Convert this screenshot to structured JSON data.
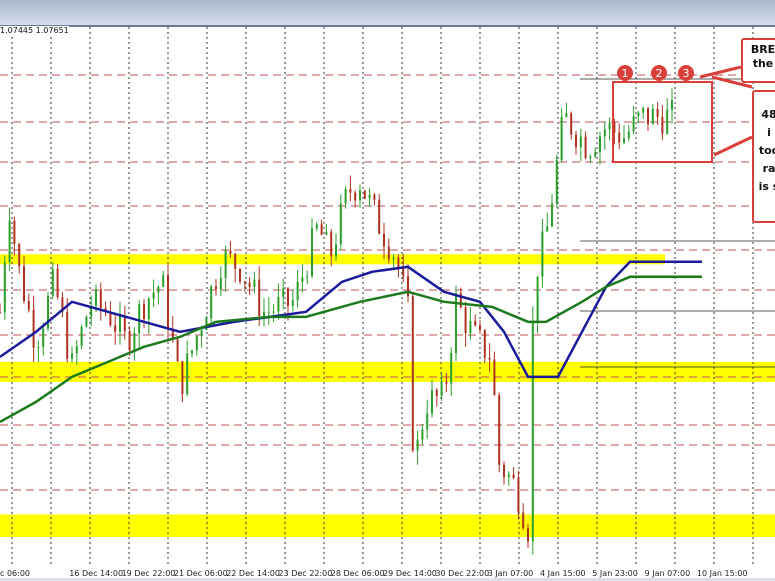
{
  "header": {
    "ohlc_text": "1.07445 1.07651"
  },
  "chart_data": {
    "type": "candlestick",
    "title": "",
    "xlabel": "",
    "ylabel": "",
    "x_tick_labels": [
      "c 06:00",
      "16 Dec 14:00",
      "19 Dec 22:00",
      "21 Dec 06:00",
      "22 Dec 14:00",
      "23 Dec 22:00",
      "28 Dec 06:00",
      "29 Dec 14:00",
      "30 Dec 22:00",
      "3 Jan 07:00",
      "4 Jan 15:00",
      "5 Jan 23:00",
      "9 Jan 07:00",
      "10 Jan 15:00"
    ],
    "ylim": [
      0,
      100
    ],
    "price_path": [
      [
        0,
        49
      ],
      [
        1.5,
        71
      ],
      [
        3,
        58
      ],
      [
        6,
        43
      ],
      [
        9,
        55
      ],
      [
        12,
        38
      ],
      [
        15,
        51
      ],
      [
        18,
        49
      ],
      [
        21,
        43
      ],
      [
        24,
        51
      ],
      [
        27,
        55
      ],
      [
        30,
        34
      ],
      [
        33,
        45
      ],
      [
        37,
        60
      ],
      [
        40,
        58
      ],
      [
        44,
        49
      ],
      [
        49,
        51
      ],
      [
        53,
        66
      ],
      [
        55,
        60
      ],
      [
        58,
        73
      ],
      [
        60,
        75
      ],
      [
        63,
        67
      ],
      [
        66,
        60
      ],
      [
        68,
        49
      ],
      [
        69,
        18
      ],
      [
        71,
        31
      ],
      [
        74,
        32
      ],
      [
        76,
        51
      ],
      [
        79,
        44
      ],
      [
        82,
        40
      ],
      [
        83,
        19
      ],
      [
        86,
        14
      ],
      [
        88,
        6
      ],
      [
        89,
        56
      ],
      [
        91,
        64
      ],
      [
        94,
        88
      ],
      [
        98,
        82
      ],
      [
        101,
        86
      ],
      [
        104,
        84
      ],
      [
        107,
        88
      ]
    ],
    "series": [
      {
        "name": "MA blue",
        "color": "#1a1a9c",
        "values": [
          [
            0,
            40
          ],
          [
            6,
            45
          ],
          [
            12,
            51
          ],
          [
            18,
            49
          ],
          [
            30,
            45
          ],
          [
            39,
            47
          ],
          [
            45,
            48
          ],
          [
            51,
            49
          ],
          [
            57,
            55
          ],
          [
            62,
            57
          ],
          [
            68,
            58
          ],
          [
            74,
            53
          ],
          [
            80,
            51
          ],
          [
            84,
            45
          ],
          [
            88,
            36
          ],
          [
            93,
            36
          ],
          [
            97,
            45
          ],
          [
            101,
            54
          ],
          [
            105,
            59
          ],
          [
            117,
            59
          ]
        ]
      },
      {
        "name": "MA green",
        "color": "#1c7a1c",
        "values": [
          [
            0,
            27
          ],
          [
            6,
            31
          ],
          [
            12,
            36
          ],
          [
            18,
            39
          ],
          [
            24,
            42
          ],
          [
            30,
            44
          ],
          [
            36,
            47
          ],
          [
            45,
            48
          ],
          [
            51,
            48
          ],
          [
            60,
            51
          ],
          [
            68,
            53
          ],
          [
            74,
            51
          ],
          [
            82,
            50
          ],
          [
            88,
            47
          ],
          [
            91,
            47
          ],
          [
            97,
            51
          ],
          [
            101,
            54
          ],
          [
            105,
            56
          ],
          [
            117,
            56
          ]
        ]
      }
    ],
    "support_zones": [
      {
        "from": 58.5,
        "to": 60.5
      },
      {
        "from": 35,
        "to": 39
      },
      {
        "from": 4,
        "to": 8.5
      }
    ],
    "annotations": {
      "markers": [
        "1",
        "2",
        "3"
      ],
      "callout1": [
        "BRE",
        "the"
      ],
      "callout2": [
        "48",
        "i",
        "too",
        "ra",
        "is s"
      ]
    },
    "colors": {
      "zone": "#ffff00",
      "annotation": "#d9403a",
      "up": "#2aa02a",
      "down": "#b03020"
    }
  }
}
